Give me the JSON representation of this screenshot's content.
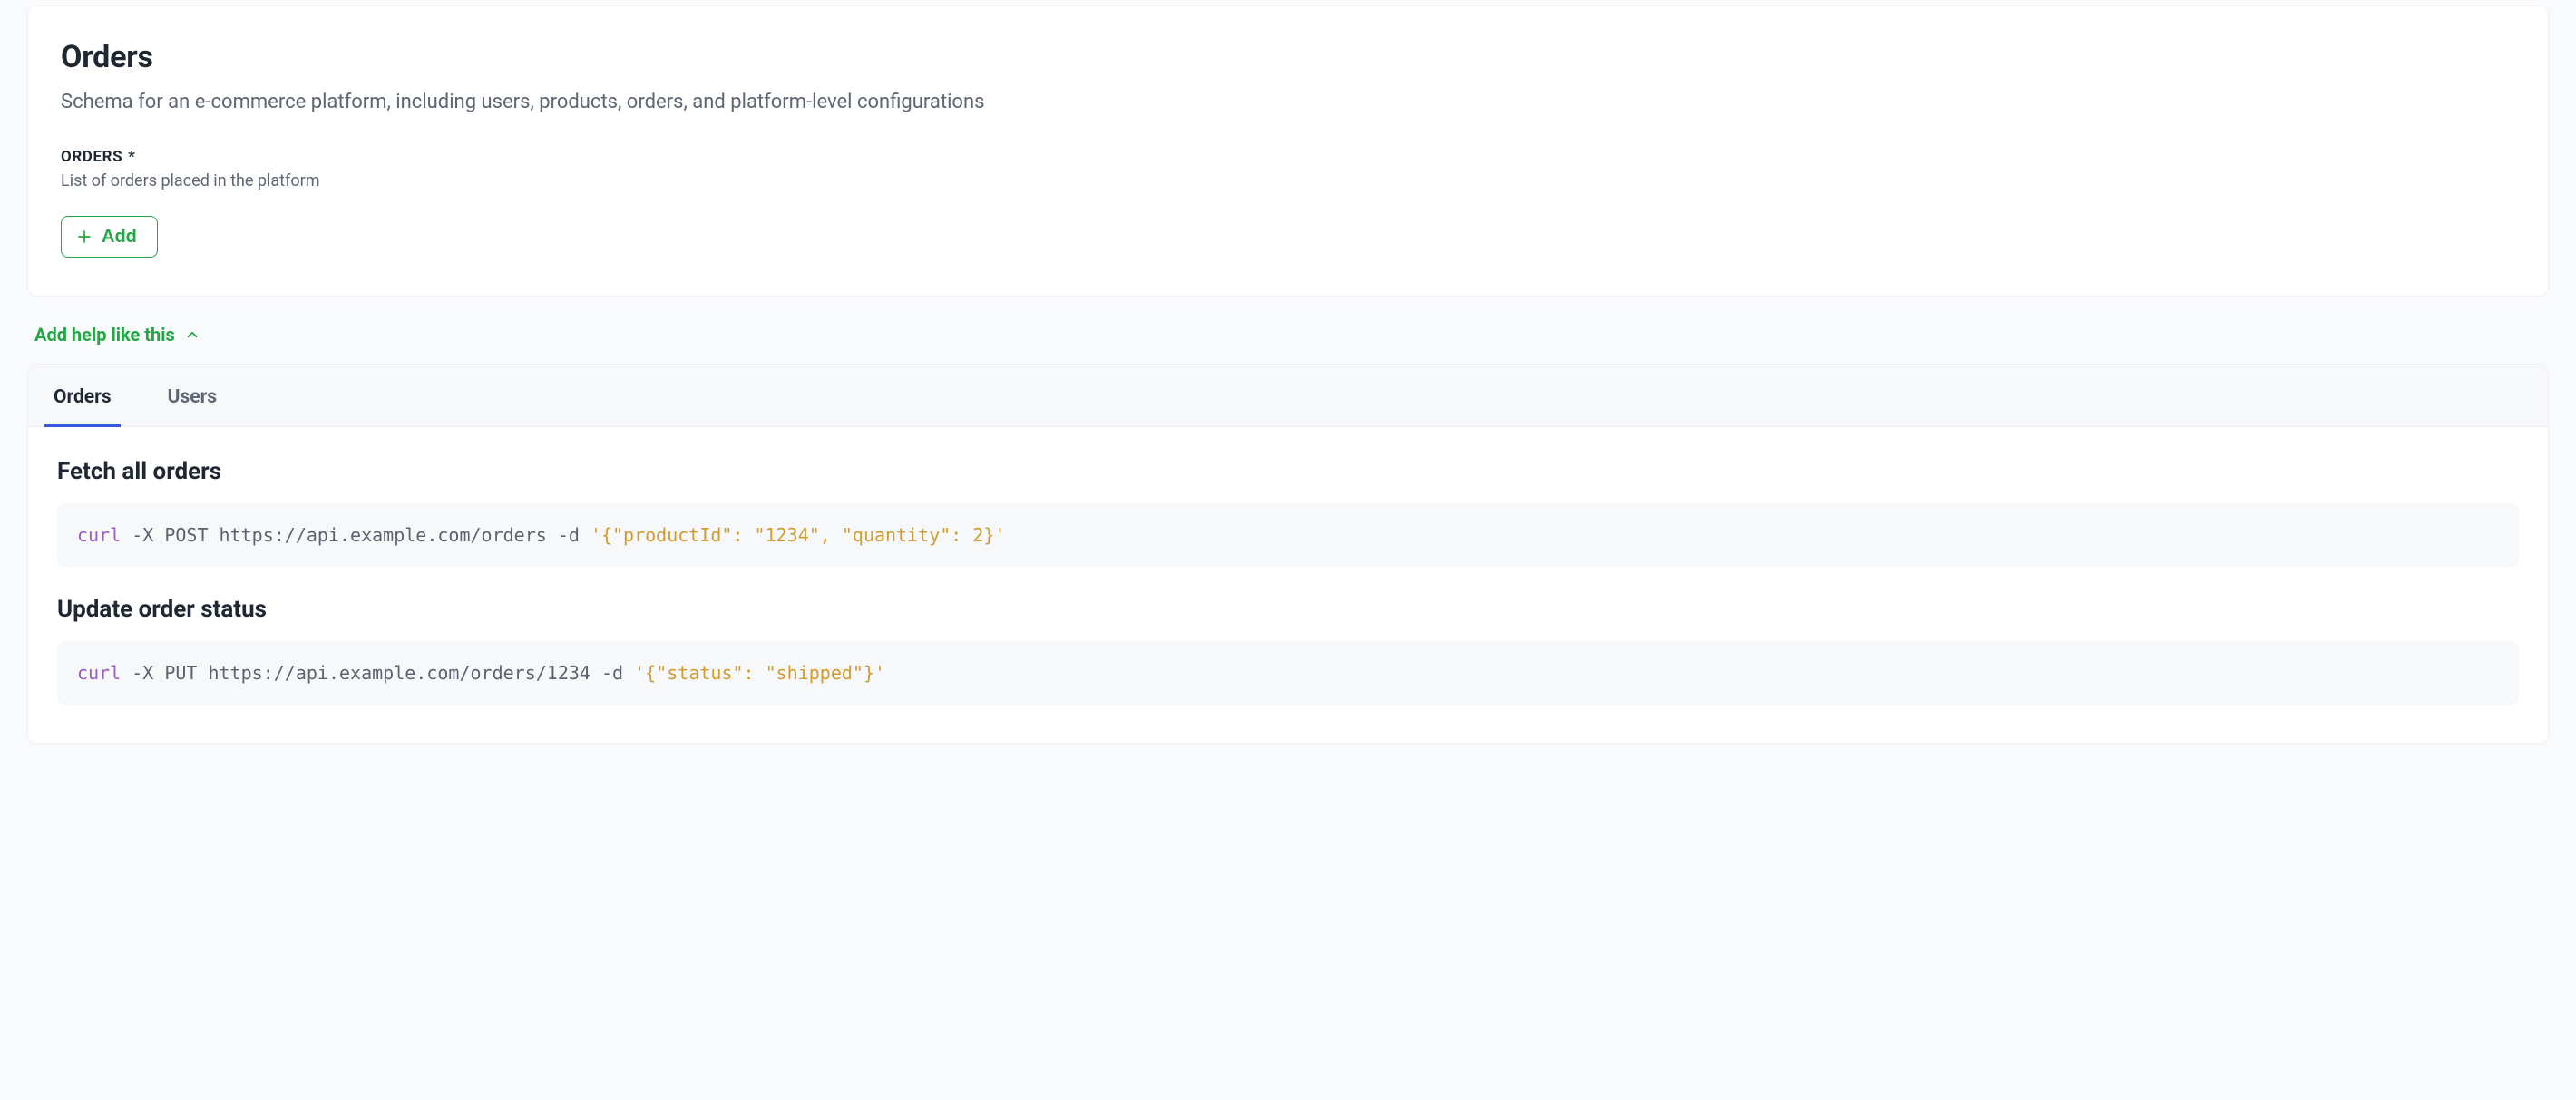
{
  "card": {
    "title": "Orders",
    "description": "Schema for an e-commerce platform, including users, products, orders, and platform-level configurations",
    "field": {
      "label": "ORDERS",
      "requiredMark": "*",
      "hint": "List of orders placed in the platform",
      "addButton": "Add"
    }
  },
  "helpToggle": {
    "label": "Add help like this"
  },
  "tabs": [
    {
      "id": "orders",
      "label": "Orders",
      "active": true
    },
    {
      "id": "users",
      "label": "Users",
      "active": false
    }
  ],
  "help": {
    "sections": [
      {
        "heading": "Fetch all orders",
        "codeParts": {
          "cmd": "curl",
          "mid": " -X POST https://api.example.com/orders -d ",
          "str": "'{\"productId\": \"1234\", \"quantity\": 2}'"
        }
      },
      {
        "heading": "Update order status",
        "codeParts": {
          "cmd": "curl",
          "mid": " -X PUT https://api.example.com/orders/1234 -d ",
          "str": "'{\"status\": \"shipped\"}'"
        }
      }
    ]
  }
}
